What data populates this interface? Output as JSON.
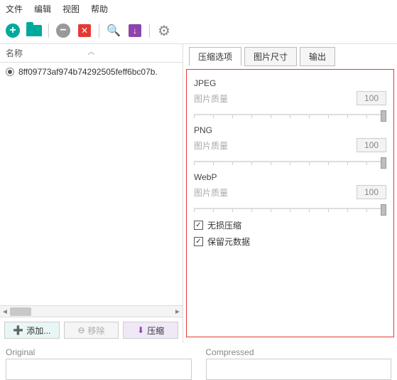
{
  "menu": {
    "file": "文件",
    "edit": "编辑",
    "view": "视图",
    "help": "帮助"
  },
  "list": {
    "header": "名称",
    "items": [
      "8ff09773af974b74292505feff6bc07b."
    ]
  },
  "left_buttons": {
    "add": "添加...",
    "remove": "移除",
    "compress": "压缩"
  },
  "tabs": {
    "compress_options": "压缩选项",
    "image_size": "图片尺寸",
    "output": "输出"
  },
  "groups": [
    {
      "title": "JPEG",
      "quality_label": "图片质量",
      "value": "100"
    },
    {
      "title": "PNG",
      "quality_label": "图片质量",
      "value": "100"
    },
    {
      "title": "WebP",
      "quality_label": "图片质量",
      "value": "100"
    }
  ],
  "checks": {
    "lossless": "无损压缩",
    "metadata": "保留元数据"
  },
  "preview": {
    "original": "Original",
    "compressed": "Compressed"
  }
}
